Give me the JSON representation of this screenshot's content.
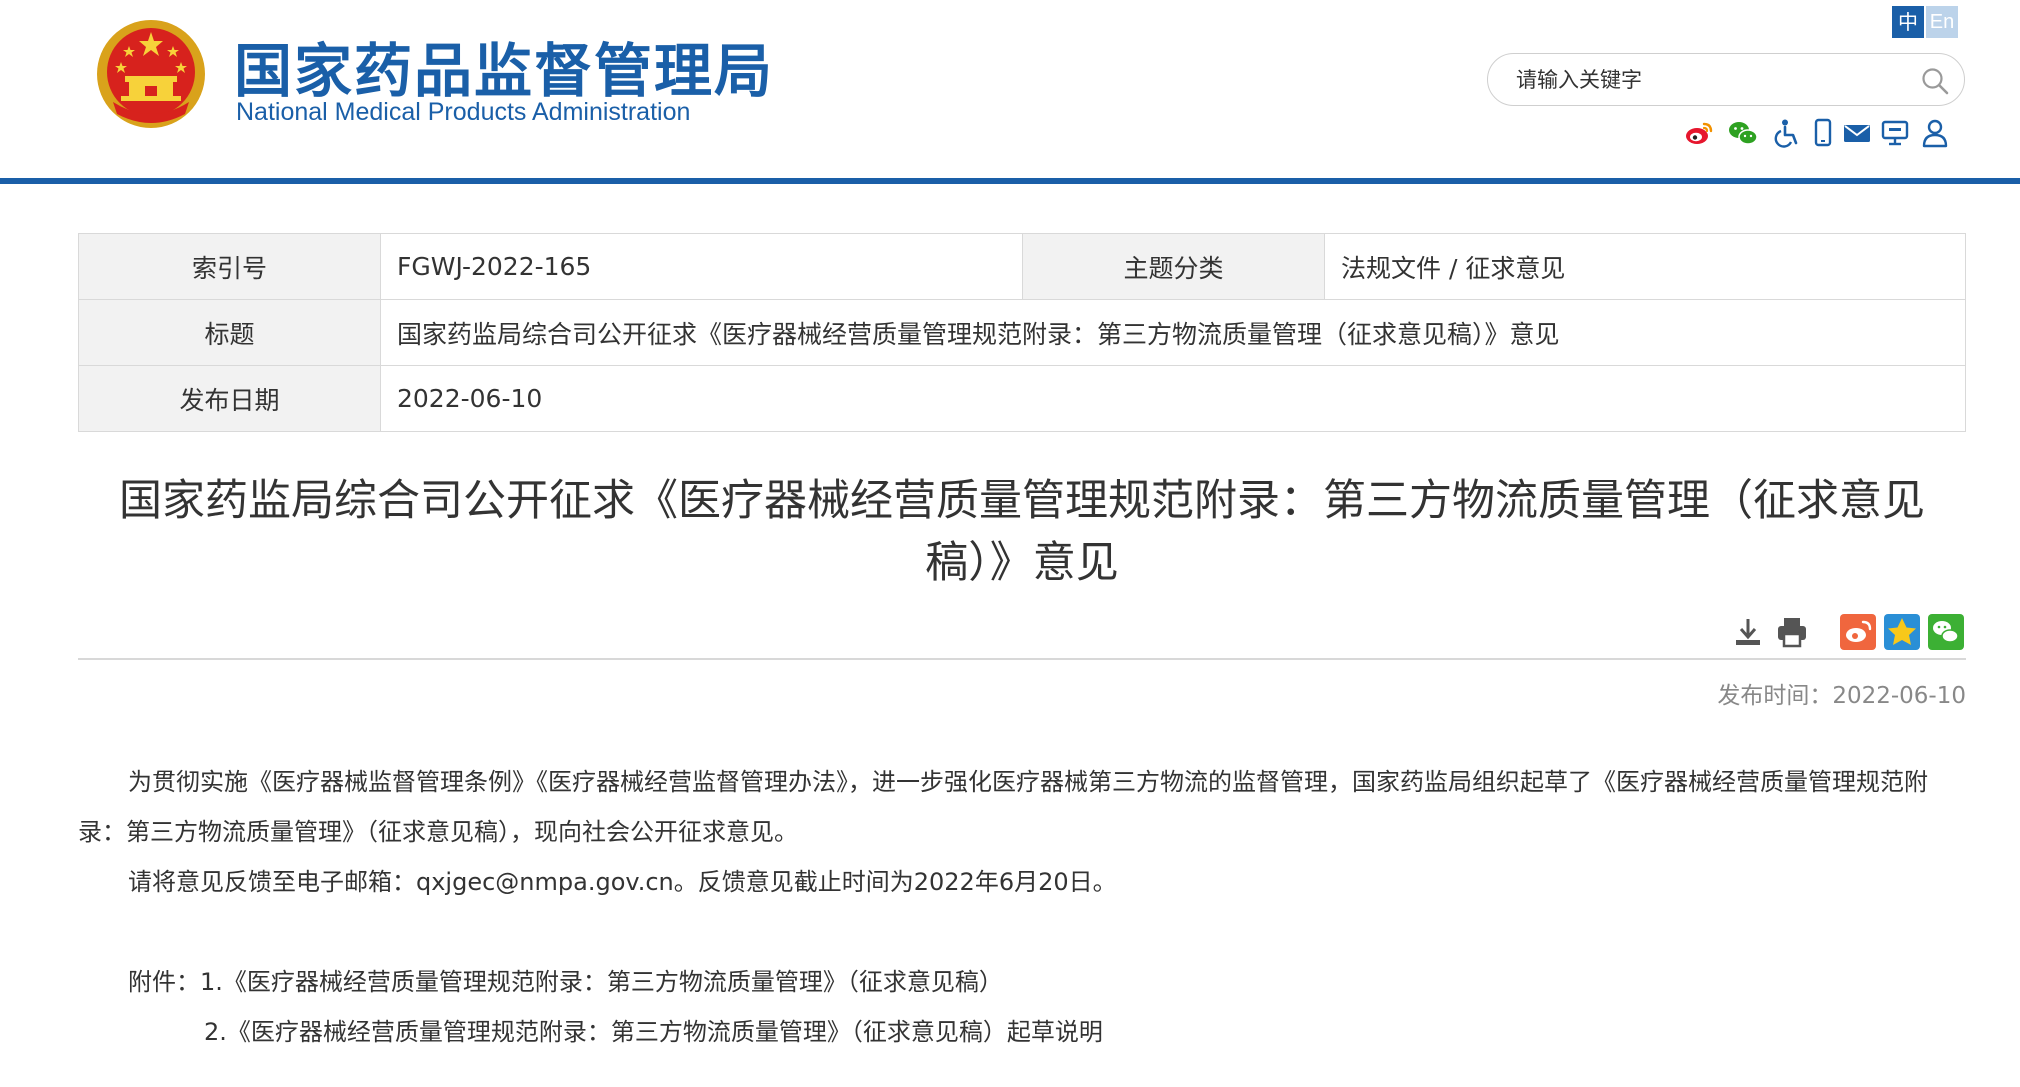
{
  "header": {
    "site_name_cn": "国家药品监督管理局",
    "site_name_en": "National Medical Products Administration",
    "lang_cn": "中",
    "lang_en": "En",
    "search_placeholder": "请输入关键字",
    "icons": [
      "weibo-icon",
      "wechat-icon",
      "accessibility-icon",
      "mobile-icon",
      "mail-icon",
      "monitor-icon",
      "user-icon"
    ],
    "brand_color": "#1a5fa8"
  },
  "info_table": {
    "index_label": "索引号",
    "index_value": "FGWJ-2022-165",
    "category_label": "主题分类",
    "category_value": "法规文件 / 征求意见",
    "title_label": "标题",
    "title_value": "国家药监局综合司公开征求《医疗器械经营质量管理规范附录：第三方物流质量管理（征求意见稿）》意见",
    "date_label": "发布日期",
    "date_value": "2022-06-10"
  },
  "article": {
    "title": "国家药监局综合司公开征求《医疗器械经营质量管理规范附录：第三方物流质量管理（征求意见稿）》意见",
    "share_icons": [
      "download-icon",
      "print-icon",
      "weibo-share-icon",
      "qzone-share-icon",
      "wechat-share-icon"
    ],
    "publish_time": "发布时间：2022-06-10",
    "paragraph_1": "为贯彻实施《医疗器械监督管理条例》《医疗器械经营监督管理办法》，进一步强化医疗器械第三方物流的监督管理，国家药监局组织起草了《医疗器械经营质量管理规范附录：第三方物流质量管理》（征求意见稿），现向社会公开征求意见。",
    "paragraph_2": "请将意见反馈至电子邮箱：qxjgec@nmpa.gov.cn。反馈意见截止时间为2022年6月20日。",
    "attachment_1": "附件：1.《医疗器械经营质量管理规范附录：第三方物流质量管理》（征求意见稿）",
    "attachment_2": "2.《医疗器械经营质量管理规范附录：第三方物流质量管理》（征求意见稿）起草说明"
  }
}
